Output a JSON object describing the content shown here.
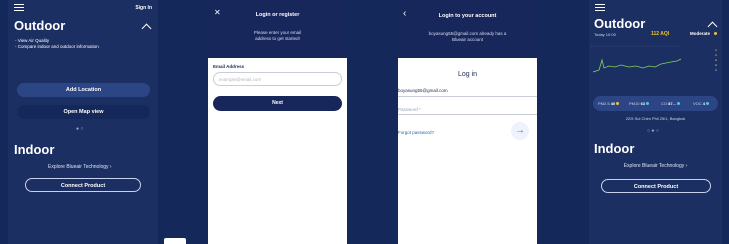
{
  "screen1": {
    "signin_label": "Sign In",
    "outdoor_title": "Outdoor",
    "bullets": [
      "- View Air Quality",
      "- Compare indoor and outdoor information"
    ],
    "add_location": "Add Location",
    "open_map": "Open Map view",
    "indoor_title": "Indoor",
    "explore": "Explore Blueair Technology ›",
    "connect": "Connect Product"
  },
  "screen2": {
    "title": "Login or register",
    "subtitle": "Please enter your email address to get started!",
    "email_label": "Email Address",
    "email_placeholder": "example@email.com",
    "next": "Next"
  },
  "screen3": {
    "title": "Login to your account",
    "subtitle": "boyasung55@gmail.com already has a Blueair account",
    "login_label": "Log in",
    "email_value": "boyasung55@gmail.com",
    "password_placeholder": "Password *",
    "forgot": "Forgot password?"
  },
  "screen4": {
    "outdoor_title": "Outdoor",
    "time_label": "Today 10:00",
    "aqi": "112 AQI",
    "status": "Moderate",
    "metrics": [
      {
        "label": "PM2.5",
        "value": "40",
        "color": "#f2c230"
      },
      {
        "label": "PM10",
        "value": "63",
        "color": "#4fc3f7"
      },
      {
        "label": "CO",
        "value": "87...",
        "color": "#4fc3f7"
      },
      {
        "label": "VOC",
        "value": "4",
        "color": "#4fc3f7"
      }
    ],
    "location": "22/5 Soi Chim Phli 25/1, Bangkok",
    "indoor_title": "Indoor",
    "explore": "Explore Blueair Technology ›",
    "connect": "Connect Product"
  },
  "colors": {
    "dark_bg": "#1c2f63",
    "primary": "#17275c",
    "accent_line": "#7fd35a",
    "aqi_yellow": "#f2c230"
  }
}
